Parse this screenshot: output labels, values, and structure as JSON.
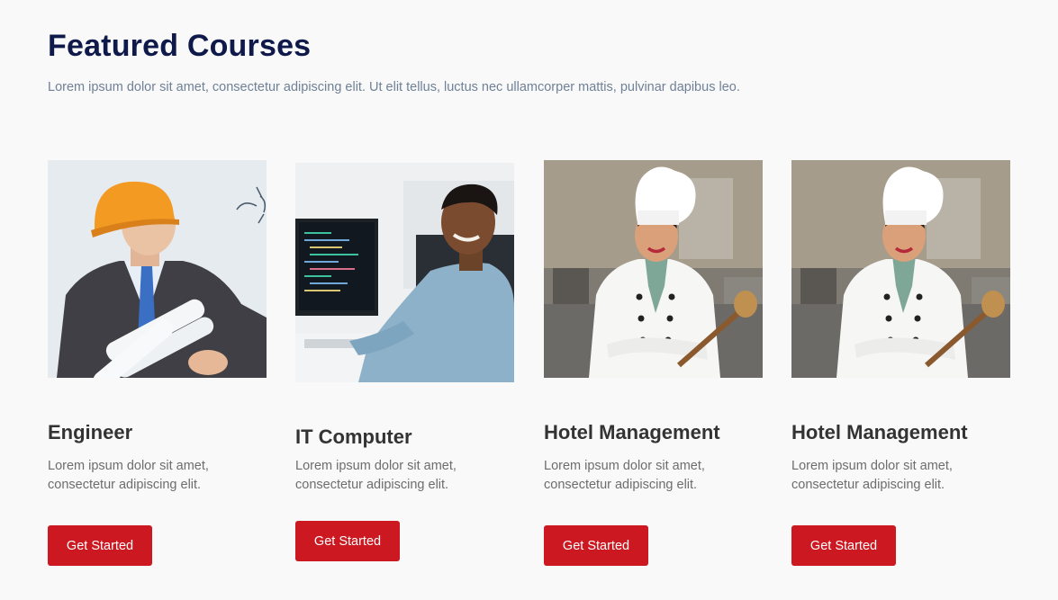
{
  "header": {
    "title": "Featured Courses",
    "subtitle": "Lorem ipsum dolor sit amet, consectetur adipiscing elit. Ut elit tellus, luctus nec ullamcorper mattis, pulvinar dapibus leo."
  },
  "courses": [
    {
      "title": "Engineer",
      "description": "Lorem ipsum dolor sit amet, consectetur adipiscing elit.",
      "button_label": "Get Started"
    },
    {
      "title": "IT Computer",
      "description": "Lorem ipsum dolor sit amet, consectetur adipiscing elit.",
      "button_label": "Get Started"
    },
    {
      "title": "Hotel Management",
      "description": "Lorem ipsum dolor sit amet, consectetur adipiscing elit.",
      "button_label": "Get Started"
    },
    {
      "title": "Hotel Management",
      "description": "Lorem ipsum dolor sit amet, consectetur adipiscing elit.",
      "button_label": "Get Started"
    }
  ],
  "colors": {
    "title": "#0f1a4a",
    "button": "#cc1820",
    "background": "#f9f9fa"
  }
}
